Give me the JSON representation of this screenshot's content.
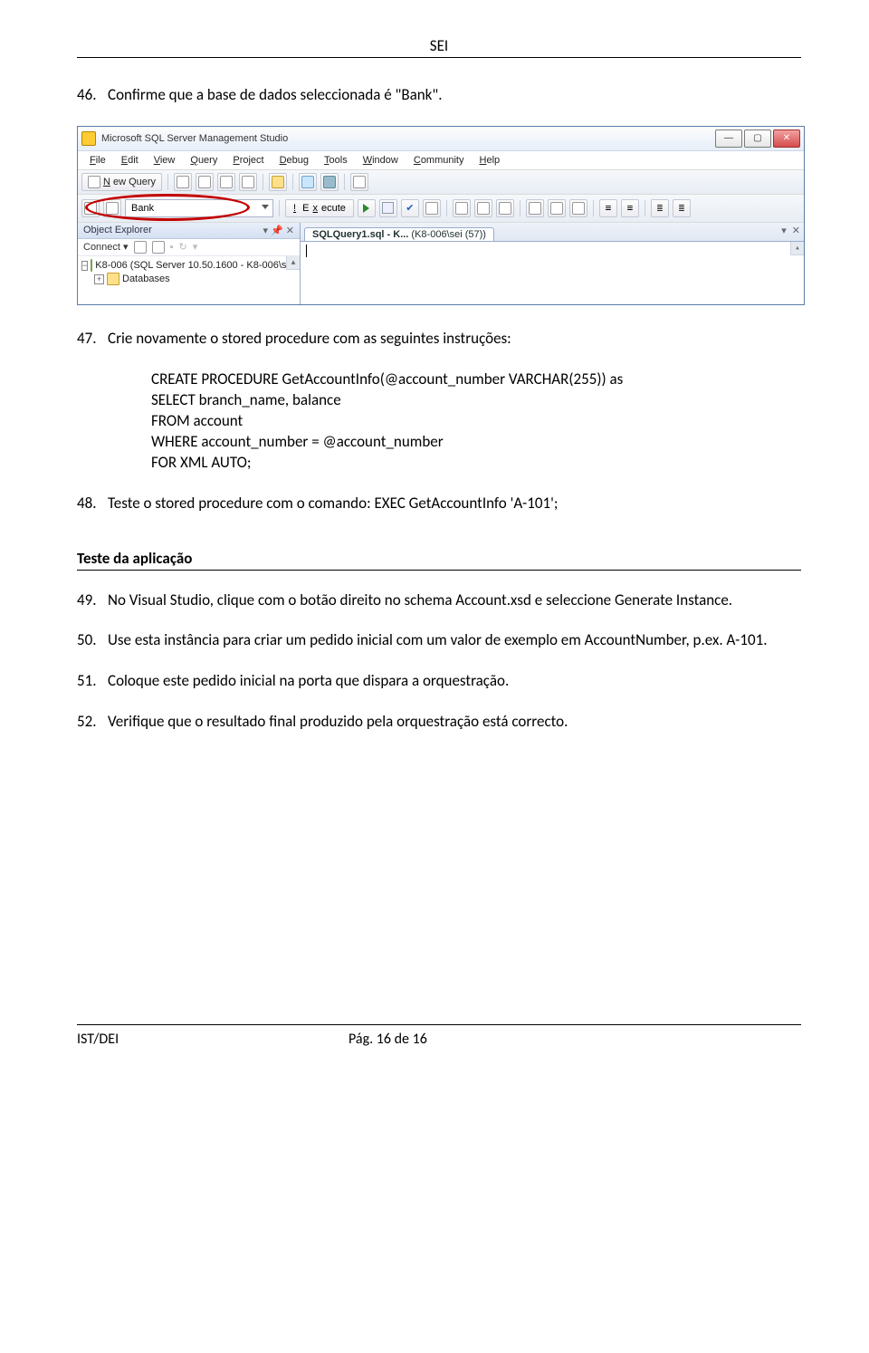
{
  "header": {
    "label": "SEI"
  },
  "footer": {
    "left": "IST/DEI",
    "center": "Pág. 16 de 16"
  },
  "items": {
    "i46": {
      "num": "46.",
      "text": "Confirme que a base de dados seleccionada é \"Bank\"."
    },
    "i47": {
      "num": "47.",
      "text": "Crie novamente o stored procedure com as seguintes instruções:"
    },
    "i48": {
      "num": "48.",
      "text": "Teste o stored procedure com o comando: EXEC GetAccountInfo 'A-101';"
    },
    "i49": {
      "num": "49.",
      "text": "No Visual Studio, clique com o botão direito no schema Account.xsd e seleccione Generate Instance."
    },
    "i50": {
      "num": "50.",
      "text": "Use esta instância para criar um pedido inicial com um valor de exemplo em AccountNumber, p.ex. A-101."
    },
    "i51": {
      "num": "51.",
      "text": "Coloque este pedido inicial na porta que dispara a orquestração."
    },
    "i52": {
      "num": "52.",
      "text": "Verifique que o resultado final produzido pela orquestração está correcto."
    }
  },
  "code": {
    "l1": "CREATE PROCEDURE GetAccountInfo(@account_number VARCHAR(255)) as",
    "l2": "SELECT branch_name, balance",
    "l3": "FROM account",
    "l4": "WHERE account_number = @account_number",
    "l5": "FOR XML AUTO;"
  },
  "section": {
    "heading": "Teste da aplicação"
  },
  "ssms": {
    "title": "Microsoft SQL Server Management Studio",
    "menus": {
      "file": "File",
      "edit": "Edit",
      "view": "View",
      "query": "Query",
      "project": "Project",
      "debug": "Debug",
      "tools": "Tools",
      "window": "Window",
      "community": "Community",
      "help": "Help"
    },
    "toolbar1": {
      "newQuery": "New Query"
    },
    "toolbar2": {
      "database": "Bank",
      "execute": "Execute"
    },
    "objectExplorer": {
      "title": "Object Explorer",
      "connect": "Connect",
      "server": "K8-006 (SQL Server 10.50.1600 - K8-006\\sei",
      "databases": "Databases"
    },
    "docTab": {
      "file": "SQLQuery1.sql - K...",
      "context": "(K8-006\\sei (57))"
    },
    "winButtons": {
      "min": "—",
      "max": "▢",
      "close": "✕"
    },
    "pins": {
      "pin": "✱",
      "down": "▾",
      "x": "✕",
      "up": "▴"
    }
  }
}
